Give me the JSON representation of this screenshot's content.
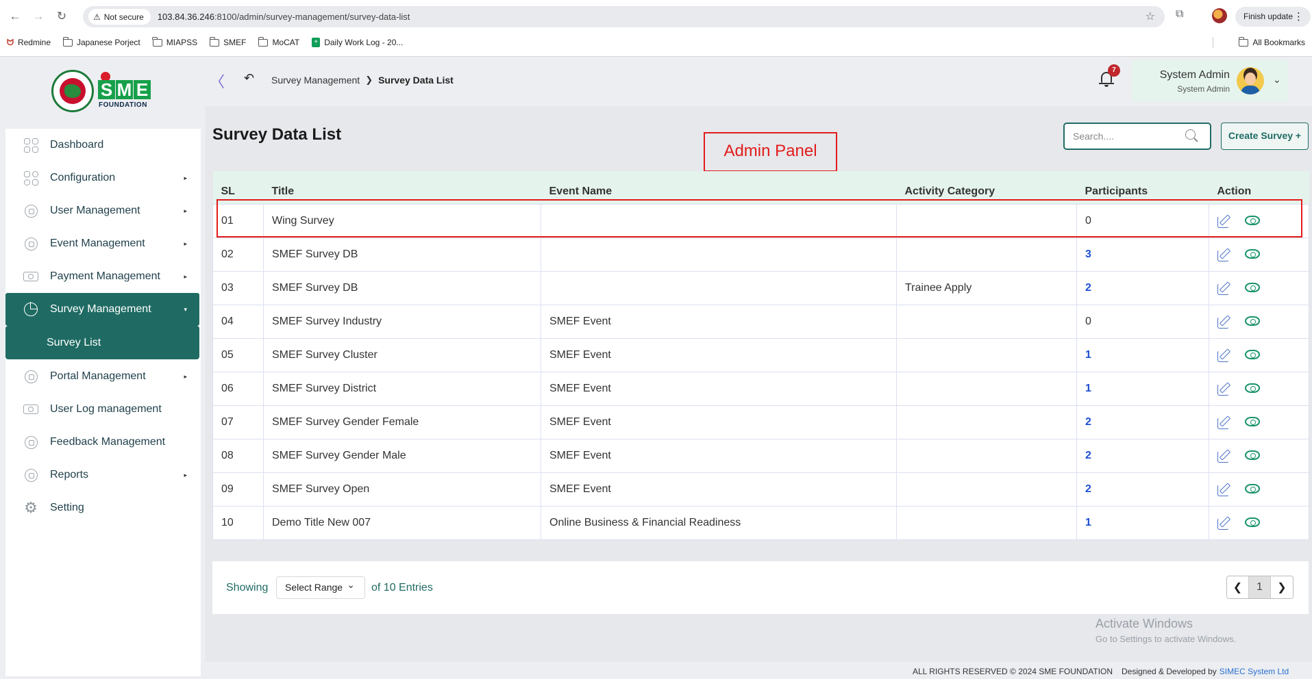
{
  "browser": {
    "security_label": "Not secure",
    "url_host": "103.84.36.246",
    "url_rest": ":8100/admin/survey-management/survey-data-list",
    "finish_update": "Finish update",
    "bookmarks": [
      {
        "label": "Redmine",
        "icon": "redmine-icon"
      },
      {
        "label": "Japanese Porject",
        "icon": "folder-icon"
      },
      {
        "label": "MIAPSS",
        "icon": "folder-icon"
      },
      {
        "label": "SMEF",
        "icon": "folder-icon"
      },
      {
        "label": "MoCAT",
        "icon": "folder-icon"
      },
      {
        "label": "Daily Work Log - 20...",
        "icon": "sheets-icon"
      }
    ],
    "all_bookmarks": "All Bookmarks"
  },
  "logo": {
    "letters": [
      "S",
      "M",
      "E"
    ],
    "subtitle": "FOUNDATION"
  },
  "sidebar": {
    "items": [
      {
        "label": "Dashboard",
        "icon": "dashboard-grid-icon",
        "has_caret": false
      },
      {
        "label": "Configuration",
        "icon": "configuration-icon",
        "has_caret": true
      },
      {
        "label": "User Management",
        "icon": "user-shield-icon",
        "has_caret": true
      },
      {
        "label": "Event Management",
        "icon": "lock-ring-icon",
        "has_caret": true
      },
      {
        "label": "Payment Management",
        "icon": "cash-icon",
        "has_caret": true
      },
      {
        "label": "Survey Management",
        "icon": "pie-chart-icon",
        "has_caret": true,
        "active": true
      },
      {
        "label": "Survey List",
        "sub": true
      },
      {
        "label": "Portal Management",
        "icon": "lock-ring-icon",
        "has_caret": true
      },
      {
        "label": "User Log management",
        "icon": "cash-icon",
        "has_caret": false
      },
      {
        "label": "Feedback Management",
        "icon": "feedback-icon",
        "has_caret": false
      },
      {
        "label": "Reports",
        "icon": "lock-ring-icon",
        "has_caret": true
      },
      {
        "label": "Setting",
        "icon": "gear-icon",
        "has_caret": false
      }
    ]
  },
  "header": {
    "breadcrumb": [
      "Survey Management",
      "Survey Data List"
    ],
    "notification_count": "7",
    "user_name": "System Admin",
    "user_role": "System Admin"
  },
  "main": {
    "title": "Survey Data List",
    "annotation": "Admin Panel",
    "search_placeholder": "Search....",
    "create_button": "Create Survey +",
    "columns": [
      "SL",
      "Title",
      "Event Name",
      "Activity Category",
      "Participants",
      "Action"
    ],
    "rows": [
      {
        "sl": "01",
        "title": "Wing Survey",
        "event": "",
        "category": "",
        "participants": "0"
      },
      {
        "sl": "02",
        "title": "SMEF Survey DB",
        "event": "",
        "category": "",
        "participants": "3"
      },
      {
        "sl": "03",
        "title": "SMEF Survey DB",
        "event": "",
        "category": "Trainee Apply",
        "participants": "2"
      },
      {
        "sl": "04",
        "title": "SMEF Survey Industry",
        "event": "SMEF Event",
        "category": "",
        "participants": "0"
      },
      {
        "sl": "05",
        "title": "SMEF Survey Cluster",
        "event": "SMEF Event",
        "category": "",
        "participants": "1"
      },
      {
        "sl": "06",
        "title": "SMEF Survey District",
        "event": "SMEF Event",
        "category": "",
        "participants": "1"
      },
      {
        "sl": "07",
        "title": "SMEF Survey Gender Female",
        "event": "SMEF Event",
        "category": "",
        "participants": "2"
      },
      {
        "sl": "08",
        "title": "SMEF Survey Gender Male",
        "event": "SMEF Event",
        "category": "",
        "participants": "2"
      },
      {
        "sl": "09",
        "title": "SMEF Survey Open",
        "event": "SMEF Event",
        "category": "",
        "participants": "2"
      },
      {
        "sl": "10",
        "title": "Demo Title New 007",
        "event": "Online Business & Financial Readiness",
        "category": "",
        "participants": "1"
      }
    ],
    "pagination": {
      "showing": "Showing",
      "range_select": "Select Range",
      "entries": "of 10 Entries",
      "current_page": "1"
    }
  },
  "watermark": {
    "title": "Activate Windows",
    "subtitle": "Go to Settings to activate Windows."
  },
  "footer": {
    "rights": "ALL RIGHTS RESERVED © 2024 SME FOUNDATION",
    "designed_by": "Designed & Developed by",
    "company": "SIMEC System Ltd"
  },
  "colors": {
    "brand_teal": "#1f6b63",
    "link_blue": "#1e4fd1",
    "annotation_red": "#e21b1b",
    "badge_red": "#c0282d"
  }
}
